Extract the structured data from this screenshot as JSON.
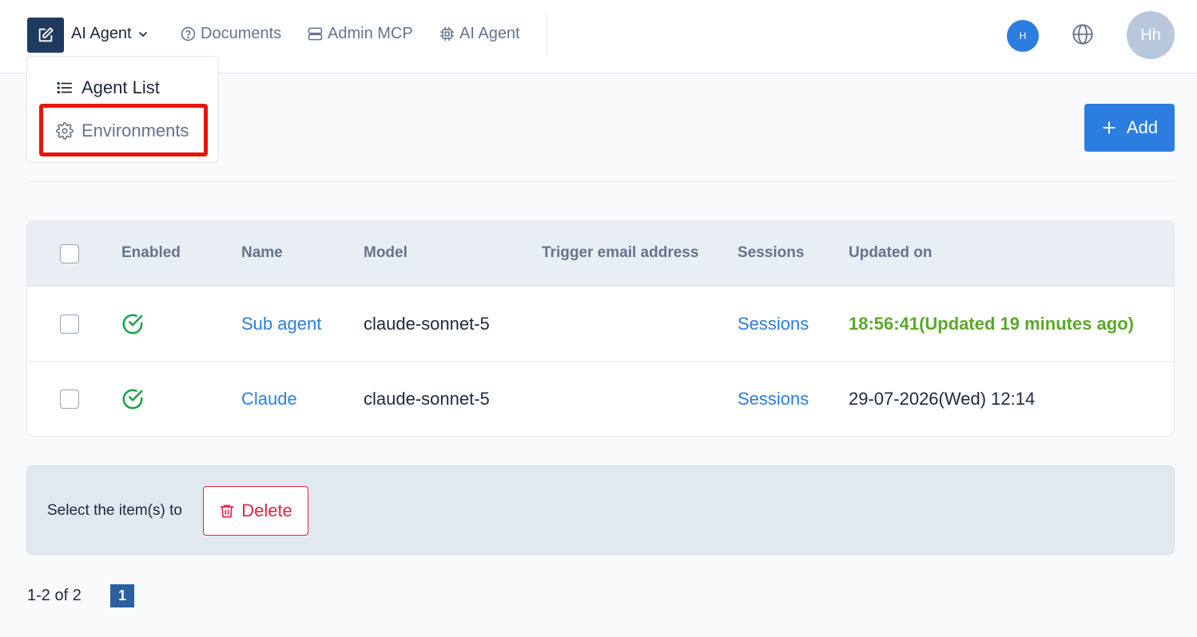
{
  "header": {
    "menu_trigger_label": "AI Agent",
    "nav": [
      {
        "label": "Documents",
        "icon": "help-circle-icon"
      },
      {
        "label": "Admin MCP",
        "icon": "server-icon"
      },
      {
        "label": "AI Agent",
        "icon": "cpu-chip-icon"
      }
    ],
    "small_avatar": "H",
    "user_avatar": "Hh"
  },
  "dropdown": {
    "items": [
      {
        "label": "Agent List",
        "icon": "list-icon"
      },
      {
        "label": "Environments",
        "icon": "gear-icon"
      }
    ]
  },
  "toolbar": {
    "add_label": "Add"
  },
  "table": {
    "columns": [
      "Enabled",
      "Name",
      "Model",
      "Trigger email address",
      "Sessions",
      "Updated on"
    ],
    "rows": [
      {
        "enabled": true,
        "name": "Sub agent",
        "model": "claude-sonnet-5",
        "trigger_email": "",
        "sessions": "Sessions",
        "updated": "18:56:41(Updated 19 minutes ago)"
      },
      {
        "enabled": true,
        "name": "Claude",
        "model": "claude-sonnet-5",
        "trigger_email": "",
        "sessions": "Sessions",
        "updated": "29-07-2026(Wed) 12:14"
      }
    ]
  },
  "bulk": {
    "text": "Select the item(s) to",
    "delete_label": "Delete"
  },
  "pagination": {
    "range": "1-2 of 2",
    "current_page": "1"
  },
  "colors": {
    "primary": "#2b7ee0",
    "brand_dark": "#1f3a5f",
    "success": "#5ba82a",
    "danger": "#dc2646",
    "highlight": "#e8140c"
  }
}
